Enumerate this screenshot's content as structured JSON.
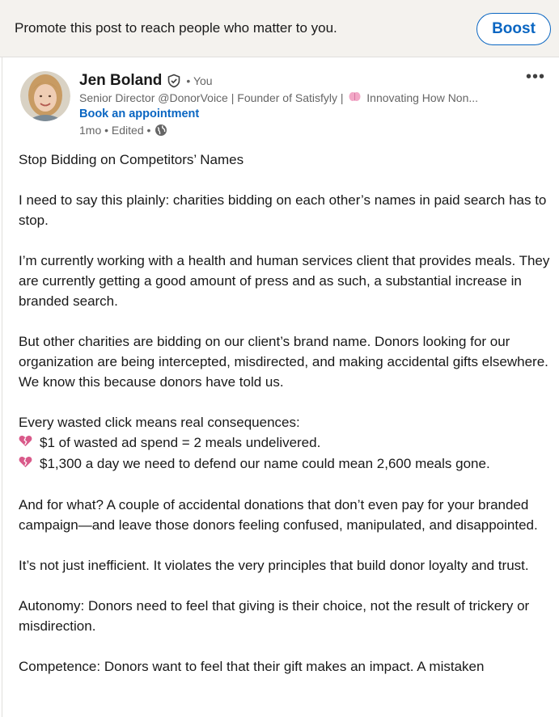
{
  "promo": {
    "text": "Promote this post to reach people who matter to you.",
    "boost_label": "Boost"
  },
  "author": {
    "name": "Jen Boland",
    "you_label": "• You",
    "headline_part1": "Senior Director @DonorVoice | Founder of Satisfyly |",
    "headline_part2": "Innovating How Non...",
    "cta": "Book an appointment",
    "meta": "1mo • Edited •"
  },
  "menu": {
    "more_label": "•••"
  },
  "post": {
    "title": "Stop Bidding on Competitors’ Names",
    "p1": "I need to say this plainly: charities bidding on each other’s names in paid search has to stop.",
    "p2": "I’m currently working with a health and human services client that provides meals. They are currently getting a good amount of press and as such, a substantial increase in branded search.",
    "p3": "But other charities are bidding on our client’s brand name. Donors looking for our organization are being intercepted, misdirected, and making accidental gifts elsewhere. We know this because donors have told us.",
    "p4_intro": "Every wasted click means real consequences:",
    "bullets": [
      "$1 of wasted ad spend = 2 meals undelivered.",
      "$1,300 a day we need to defend our name could mean 2,600 meals gone."
    ],
    "p5": "And for what? A couple of accidental donations that don’t even pay for your branded campaign—and leave those donors feeling confused, manipulated, and disappointed.",
    "p6": "It’s not just inefficient. It violates the very principles that build donor loyalty and trust.",
    "p7": "Autonomy: Donors need to feel that giving is their choice, not the result of trickery or misdirection.",
    "p8": "Competence: Donors want to feel that their gift makes an impact. A mistaken"
  },
  "icons": {
    "verified": "shield-check-icon",
    "brain": "brain-icon",
    "globe": "globe-icon",
    "broken_heart": "broken-heart-icon"
  },
  "colors": {
    "accent": "#0a66c2",
    "promo_bg": "#f4f2ee",
    "muted_text": "#666666",
    "heart": "#d95a8a"
  }
}
